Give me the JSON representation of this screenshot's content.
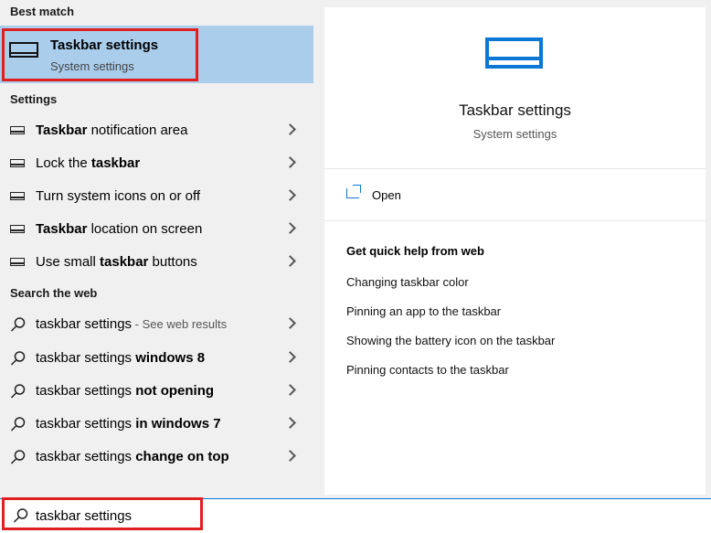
{
  "best_match": {
    "heading": "Best match",
    "title": "Taskbar settings",
    "subtitle": "System settings"
  },
  "settings": {
    "heading": "Settings",
    "items": [
      {
        "bold": "Taskbar",
        "rest": " notification area"
      },
      {
        "pre": "Lock the ",
        "bold": "taskbar"
      },
      {
        "pre": "Turn system icons on or off"
      },
      {
        "bold": "Taskbar",
        "rest": " location on screen"
      },
      {
        "pre": "Use small ",
        "bold": "taskbar",
        "rest": " buttons"
      }
    ]
  },
  "web": {
    "heading": "Search the web",
    "items": [
      {
        "pre": "taskbar settings",
        "suffix": " - See web results"
      },
      {
        "pre": "taskbar settings ",
        "bold": "windows 8"
      },
      {
        "pre": "taskbar settings ",
        "bold": "not opening"
      },
      {
        "pre": "taskbar settings ",
        "bold": "in windows 7"
      },
      {
        "pre": "taskbar settings ",
        "bold": "change on top"
      }
    ]
  },
  "detail": {
    "title": "Taskbar settings",
    "subtitle": "System settings",
    "open_label": "Open",
    "help_heading": "Get quick help from web",
    "help_links": [
      "Changing taskbar color",
      "Pinning an app to the taskbar",
      "Showing the battery icon on the taskbar",
      "Pinning contacts to the taskbar"
    ]
  },
  "search": {
    "value": "taskbar settings"
  },
  "colors": {
    "accent": "#0a78d4",
    "highlight": "#aacdec",
    "annotation": "#e02020"
  }
}
